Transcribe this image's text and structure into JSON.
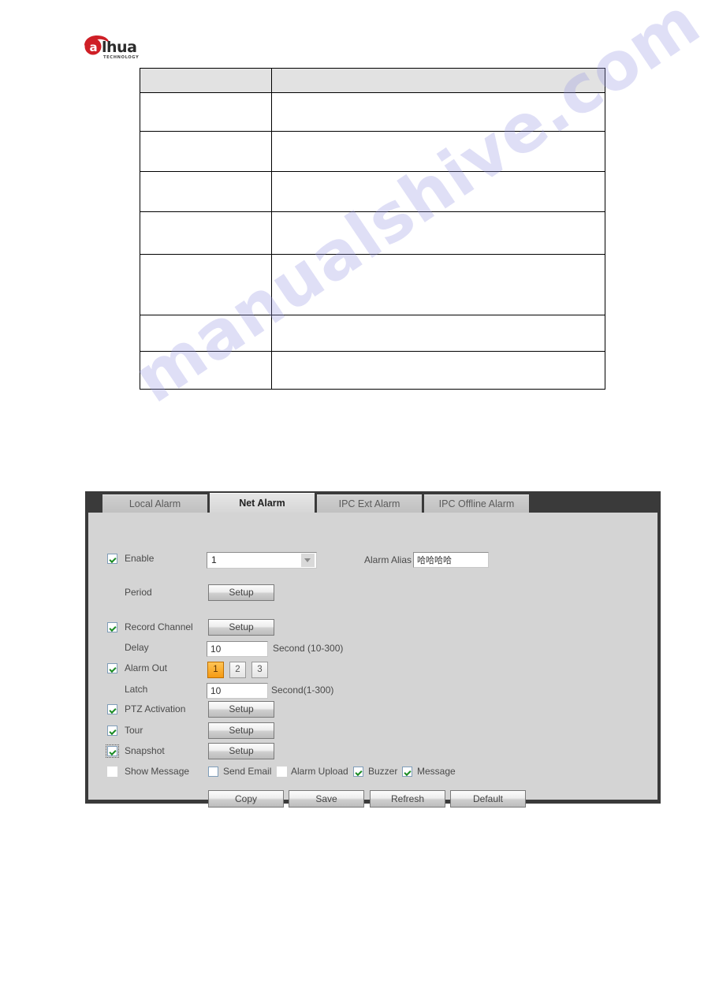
{
  "brand": {
    "name": "alhua",
    "tagline": "TECHNOLOGY"
  },
  "watermark": {
    "text": "manualshive.com"
  },
  "doc_table": {
    "header": [
      "",
      ""
    ],
    "rows": [
      [
        "",
        ""
      ],
      [
        "",
        ""
      ],
      [
        "",
        ""
      ],
      [
        "",
        ""
      ],
      [
        "",
        ""
      ],
      [
        "",
        ""
      ]
    ]
  },
  "panel": {
    "tabs": [
      {
        "label": "Local Alarm",
        "active": false
      },
      {
        "label": "Net Alarm",
        "active": true
      },
      {
        "label": "IPC Ext Alarm",
        "active": false
      },
      {
        "label": "IPC Offline Alarm",
        "active": false
      }
    ],
    "enable": {
      "label": "Enable",
      "checked": true,
      "channel_value": "1"
    },
    "alarm_alias": {
      "label": "Alarm Alias",
      "value": "哈哈哈哈"
    },
    "period": {
      "label": "Period",
      "button": "Setup"
    },
    "record_channel": {
      "label": "Record Channel",
      "checked": true,
      "button": "Setup"
    },
    "delay": {
      "label": "Delay",
      "value": "10",
      "unit": "Second (10-300)"
    },
    "alarm_out": {
      "label": "Alarm Out",
      "checked": true,
      "options": [
        "1",
        "2",
        "3"
      ],
      "selected": "1"
    },
    "latch": {
      "label": "Latch",
      "value": "10",
      "unit": "Second(1-300)"
    },
    "ptz_activation": {
      "label": "PTZ Activation",
      "checked": true,
      "button": "Setup"
    },
    "tour": {
      "label": "Tour",
      "checked": true,
      "button": "Setup"
    },
    "snapshot": {
      "label": "Snapshot",
      "checked": true,
      "button": "Setup"
    },
    "notify_row": {
      "show_message": {
        "label": "Show Message",
        "checked": false
      },
      "send_email": {
        "label": "Send Email",
        "checked": false
      },
      "alarm_upload": {
        "label": "Alarm Upload",
        "checked": false
      },
      "buzzer": {
        "label": "Buzzer",
        "checked": true
      },
      "message": {
        "label": "Message",
        "checked": true
      }
    },
    "actions": {
      "copy": "Copy",
      "save": "Save",
      "refresh": "Refresh",
      "default": "Default"
    }
  },
  "colors": {
    "accent_orange": "#f59a12",
    "check_green": "#1a8b23",
    "panel_bg": "#d4d4d4",
    "tabbar_bg": "#3a3a3a"
  }
}
